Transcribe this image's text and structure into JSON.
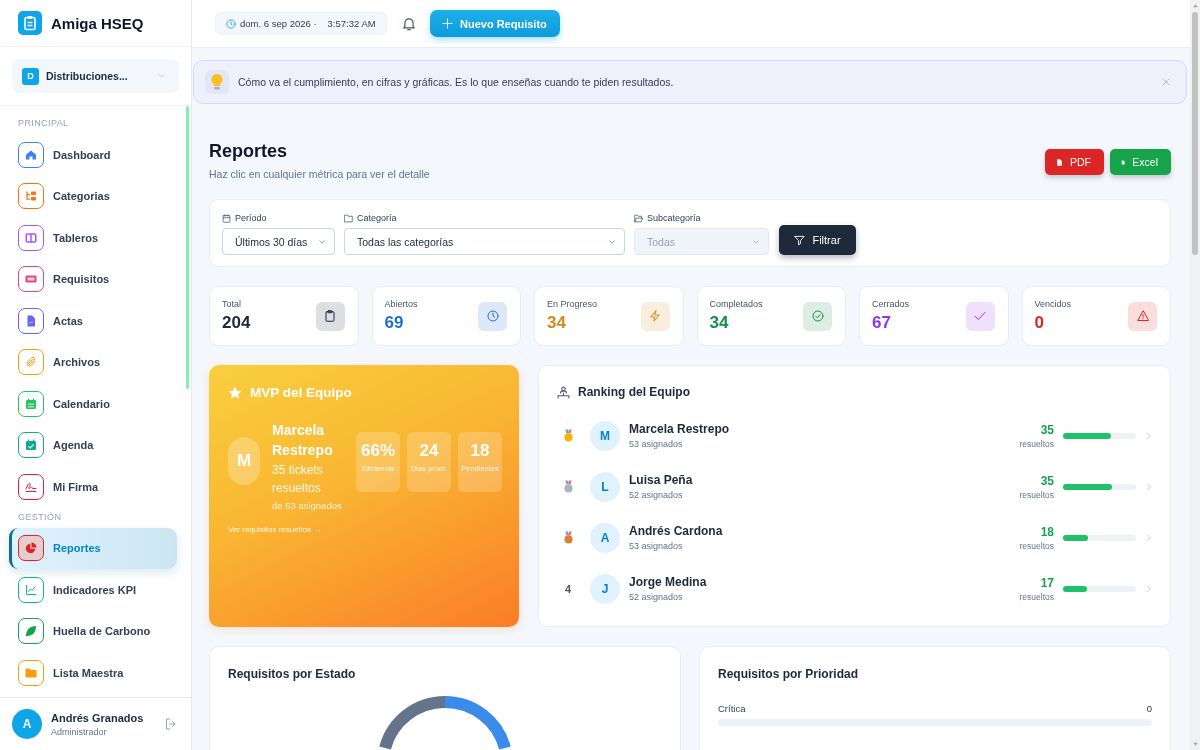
{
  "app": {
    "name": "Amiga HSEQ"
  },
  "company": {
    "initial": "D",
    "name": "Distribuciones..."
  },
  "sidebar": {
    "sections": [
      {
        "title": "PRINCIPAL",
        "items": [
          {
            "label": "Dashboard",
            "kind": "home",
            "color": "#3b82f6",
            "selected": false
          },
          {
            "label": "Categorias",
            "kind": "tree",
            "color": "#f97316",
            "selected": false
          },
          {
            "label": "Tableros",
            "kind": "columns",
            "color": "#a855f7",
            "selected": false
          },
          {
            "label": "Requisitos",
            "kind": "ticket",
            "color": "#e2487a",
            "selected": false
          },
          {
            "label": "Actas",
            "kind": "file",
            "color": "#6366f1",
            "selected": false
          },
          {
            "label": "Archivos",
            "kind": "paperclip",
            "color": "#f59e0b",
            "selected": false
          },
          {
            "label": "Calendario",
            "kind": "calendar",
            "color": "#22c55e",
            "selected": false
          },
          {
            "label": "Agenda",
            "kind": "calcheck",
            "color": "#14a98c",
            "selected": false
          },
          {
            "label": "Mi Firma",
            "kind": "signature",
            "color": "#e11d48",
            "selected": false
          }
        ]
      },
      {
        "title": "GESTIÓN",
        "items": [
          {
            "label": "Reportes",
            "kind": "pie",
            "color": "#dc2626",
            "selected": true
          },
          {
            "label": "Indicadores KPI",
            "kind": "chart",
            "color": "#10b981",
            "selected": false
          },
          {
            "label": "Huella de Carbono",
            "kind": "leaf",
            "color": "#16a34a",
            "selected": false
          },
          {
            "label": "Lista Maestra",
            "kind": "folder",
            "color": "#f59e0b",
            "selected": false
          }
        ]
      }
    ]
  },
  "user": {
    "initial": "A",
    "name": "Andrés Granados",
    "role": "Administrador"
  },
  "topbar": {
    "date": "dom. 6 sep 2026 ·",
    "time": "3:57:32 AM",
    "action": "Nuevo Requisito"
  },
  "tip": {
    "text": "Cómo va el cumplimiento, en cifras y gráficas. Es lo que enseñas cuando te piden resultados."
  },
  "header": {
    "title": "Reportes",
    "subtitle": "Haz clic en cualquier métrica para ver el detalle",
    "exports": [
      {
        "label": "PDF",
        "kind": "pdf"
      },
      {
        "label": "Excel",
        "kind": "excel"
      }
    ]
  },
  "filters": {
    "fields": [
      {
        "label": "Período",
        "kind": "calendar",
        "value": "Últimos 30 días",
        "disabled": false
      },
      {
        "label": "Categoría",
        "kind": "folder",
        "value": "Todas las categorías",
        "disabled": false
      },
      {
        "label": "Subcategoría",
        "kind": "folder-open",
        "value": "Todas",
        "disabled": true
      }
    ],
    "button": "Filtrar"
  },
  "stats": [
    {
      "label": "Total",
      "value": "204",
      "kind": "clipboard",
      "color": "#1e293b"
    },
    {
      "label": "Abiertos",
      "value": "69",
      "kind": "clock",
      "color": "#1d6fd8"
    },
    {
      "label": "En Progreso",
      "value": "34",
      "kind": "bolt",
      "color": "#d4891c"
    },
    {
      "label": "Completados",
      "value": "34",
      "kind": "check-circle",
      "color": "#15904a"
    },
    {
      "label": "Cerrados",
      "value": "67",
      "kind": "check",
      "color": "#9333ea"
    },
    {
      "label": "Vencidos",
      "value": "0",
      "kind": "alert",
      "color": "#dc2626"
    }
  ],
  "mvp": {
    "title": "MVP del Equipo",
    "initial": "M",
    "name": "Marcela Restrepo",
    "resolved": "35 tickets resueltos",
    "assigned": "de 53 asignados",
    "metrics": [
      {
        "value": "66%",
        "label": "Eficiencia"
      },
      {
        "value": "24",
        "label": "Días prom."
      },
      {
        "value": "18",
        "label": "Pendientes"
      }
    ],
    "link": "Ver requisitos resueltos →"
  },
  "ranking": {
    "title": "Ranking del Equipo",
    "rows": [
      {
        "kind": "medal",
        "color": "#f5b400",
        "initial": "M",
        "name": "Marcela Restrepo",
        "assigned": "53 asignados",
        "count": "35",
        "count_label": "resueltos",
        "level": 0.66
      },
      {
        "kind": "medal",
        "color": "#a8b4c4",
        "initial": "L",
        "name": "Luisa Peña",
        "assigned": "52 asignados",
        "count": "35",
        "count_label": "resueltos",
        "level": 0.67
      },
      {
        "kind": "medal",
        "color": "#d9822b",
        "initial": "A",
        "name": "Andrés Cardona",
        "assigned": "53 asignados",
        "count": "18",
        "count_label": "resueltos",
        "level": 0.34
      },
      {
        "kind": "number",
        "place": "4",
        "initial": "J",
        "name": "Jorge Medina",
        "assigned": "52 asignados",
        "count": "17",
        "count_label": "resueltos",
        "level": 0.33
      }
    ]
  },
  "charts": {
    "status": {
      "title": "Requisitos por Estado"
    },
    "priority": {
      "title": "Requisitos por Prioridad",
      "rows": [
        {
          "label": "Crítica",
          "value": "0",
          "level": 0
        }
      ]
    }
  }
}
